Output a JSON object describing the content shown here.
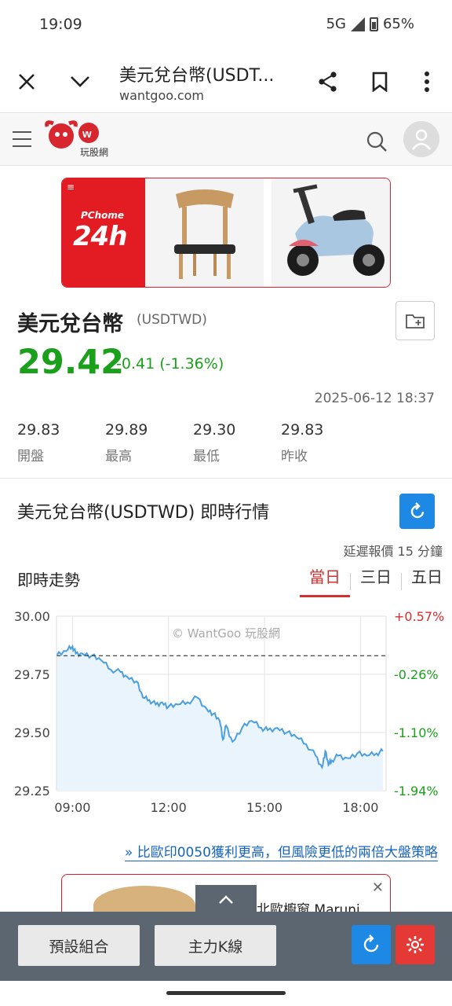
{
  "status_bar": {
    "time": "19:09",
    "network": "5G",
    "battery": "65%"
  },
  "browser": {
    "title": "美元兌台幣(USDT...",
    "url": "wantgoo.com"
  },
  "site": {
    "logo_text": "玩股網"
  },
  "ad": {
    "brand": "PChome",
    "brand_big": "24h"
  },
  "quote": {
    "name": "美元兌台幣",
    "code": "(USDTWD)",
    "price": "29.42",
    "change": "-0.41 (-1.36%)",
    "timestamp": "2025-06-12 18:37",
    "stats": [
      {
        "value": "29.83",
        "label": "開盤"
      },
      {
        "value": "29.89",
        "label": "最高"
      },
      {
        "value": "29.30",
        "label": "最低"
      },
      {
        "value": "29.83",
        "label": "昨收"
      }
    ]
  },
  "section": {
    "title": "美元兌台幣(USDTWD) 即時行情",
    "delay_note": "延遲報價 15 分鐘",
    "trend_label": "即時走勢",
    "tabs": [
      "當日",
      "三日",
      "五日"
    ],
    "active_tab": 0
  },
  "chart_data": {
    "type": "area",
    "watermark": "© WantGoo 玩股網",
    "y_ticks_left": [
      "30.00",
      "29.75",
      "29.50",
      "29.25"
    ],
    "y_ticks_right": [
      "+0.57%",
      "-0.26%",
      "-1.10%",
      "-1.94%"
    ],
    "x_ticks": [
      "09:00",
      "12:00",
      "15:00",
      "18:00"
    ],
    "ylim": [
      29.25,
      30.0
    ],
    "reference_line": 29.83,
    "colors": {
      "line": "#4a9fe0",
      "fill": "#eaf4fc",
      "up": "#d32f2f",
      "down": "#1aa01a",
      "ref": "#333333"
    },
    "x_hours": [
      8.5,
      8.8,
      9.0,
      9.1,
      9.3,
      9.6,
      9.9,
      10.2,
      10.5,
      10.7,
      11.0,
      11.2,
      11.4,
      11.6,
      11.8,
      12.0,
      12.3,
      12.6,
      12.9,
      13.2,
      13.4,
      13.6,
      13.7,
      13.8,
      14.0,
      14.3,
      14.6,
      14.9,
      15.1,
      15.4,
      15.7,
      16.0,
      16.3,
      16.6,
      16.8,
      16.9,
      17.0,
      17.1,
      17.3,
      17.6,
      17.9,
      18.2,
      18.5,
      18.7
    ],
    "values": [
      29.83,
      29.85,
      29.87,
      29.84,
      29.84,
      29.83,
      29.81,
      29.77,
      29.76,
      29.74,
      29.72,
      29.65,
      29.64,
      29.62,
      29.63,
      29.61,
      29.62,
      29.63,
      29.65,
      29.6,
      29.58,
      29.55,
      29.47,
      29.53,
      29.46,
      29.52,
      29.55,
      29.52,
      29.51,
      29.52,
      29.5,
      29.48,
      29.45,
      29.4,
      29.35,
      29.42,
      29.36,
      29.38,
      29.4,
      29.39,
      29.41,
      29.4,
      29.41,
      29.42
    ]
  },
  "promo": {
    "link": "» 比歐印0050獲利更高，但風險更低的兩倍大盤策略",
    "ad2_text": "北歐櫥窗 Maruni"
  },
  "bottom_bar": {
    "btn1": "預設組合",
    "btn2": "主力K線"
  }
}
